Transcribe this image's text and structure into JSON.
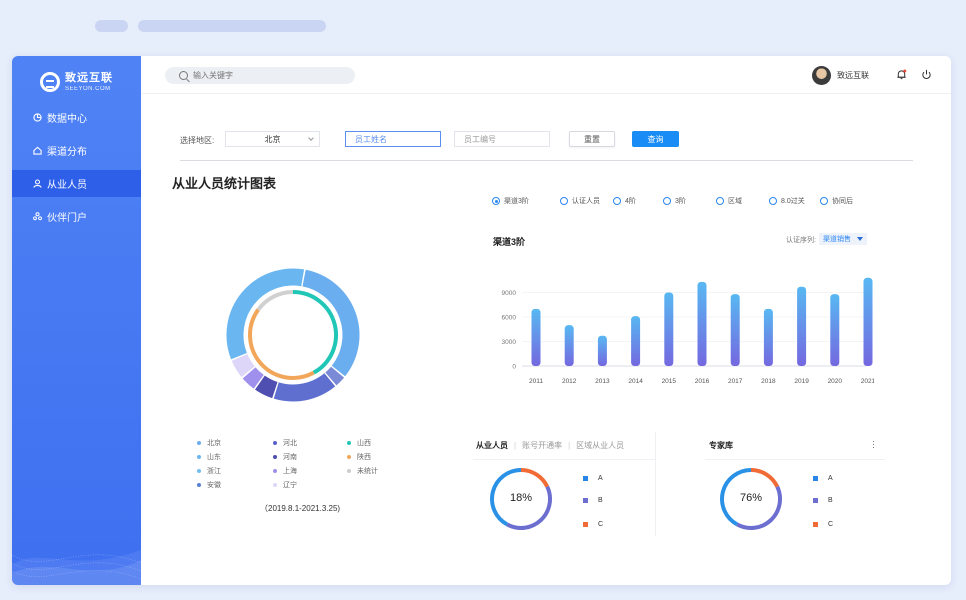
{
  "brand": {
    "name_cn": "致远互联",
    "name_en": "SEEYON.COM"
  },
  "sidebar": {
    "items": [
      {
        "label": "数据中心",
        "icon": "pie-chart-icon",
        "active": false
      },
      {
        "label": "渠道分布",
        "icon": "home-icon",
        "active": false
      },
      {
        "label": "从业人员",
        "icon": "user-icon",
        "active": true
      },
      {
        "label": "伙伴门户",
        "icon": "partners-icon",
        "active": false
      }
    ]
  },
  "topbar": {
    "search_placeholder": "输入关键字",
    "username": "致远互联"
  },
  "filter": {
    "region_label": "选择地区:",
    "region_value": "北京",
    "name_placeholder": "员工姓名",
    "id_placeholder": "员工编号",
    "reset_label": "重置",
    "query_label": "查询"
  },
  "section_title": "从业人员统计图表",
  "radios": [
    {
      "label": "渠道3阶",
      "checked": true
    },
    {
      "label": "认证人员",
      "checked": false
    },
    {
      "label": "4阶",
      "checked": false
    },
    {
      "label": "3阶",
      "checked": false
    },
    {
      "label": "区域",
      "checked": false
    },
    {
      "label": "8.0过关",
      "checked": false
    },
    {
      "label": "协同后",
      "checked": false
    }
  ],
  "legend": [
    {
      "label": "北京",
      "color": "#6aaef0"
    },
    {
      "label": "河北",
      "color": "#5a5fc8"
    },
    {
      "label": "山西",
      "color": "#20c6b6"
    },
    {
      "label": "山东",
      "color": "#69b6f0"
    },
    {
      "label": "河南",
      "color": "#4e4fb0"
    },
    {
      "label": "陕西",
      "color": "#f2a65a"
    },
    {
      "label": "浙江",
      "color": "#76bdf2"
    },
    {
      "label": "上海",
      "color": "#9e90ec"
    },
    {
      "label": "未统计",
      "color": "#cccccc"
    },
    {
      "label": "安徽",
      "color": "#5a80d6"
    },
    {
      "label": "辽宁",
      "color": "#ddd6f8"
    }
  ],
  "date_range": "（2019.8.1-2021.3.25)",
  "bar_panel": {
    "title": "渠道3阶",
    "series_label": "认证序列:",
    "series_value": "渠道销售"
  },
  "chart_data": [
    {
      "type": "pie",
      "subtype": "double-ring",
      "outer": [
        {
          "name": "北京",
          "value": 33,
          "color": "#6aaef0"
        },
        {
          "name": "河北",
          "value": 3,
          "color": "#7b8ad6"
        },
        {
          "name": "",
          "value": 16,
          "color": "#5e6fd0"
        },
        {
          "name": "河南",
          "value": 5,
          "color": "#4e4fb0"
        },
        {
          "name": "上海",
          "value": 4,
          "color": "#9e90ec"
        },
        {
          "name": "辽宁",
          "value": 5,
          "color": "#ddd6f8"
        },
        {
          "name": "山东",
          "value": 34,
          "color": "#69b6f0"
        }
      ],
      "inner": [
        {
          "name": "山西",
          "value": 42,
          "color": "#20c6b6"
        },
        {
          "name": "陕西",
          "value": 43,
          "color": "#f2a65a"
        },
        {
          "name": "未统计",
          "value": 15,
          "color": "#d0d0d0"
        }
      ]
    },
    {
      "type": "bar",
      "categories": [
        "2011",
        "2012",
        "2013",
        "2014",
        "2015",
        "2016",
        "2017",
        "2018",
        "2019",
        "2020",
        "2021"
      ],
      "values": [
        7000,
        5000,
        3700,
        6100,
        9000,
        10300,
        8800,
        7000,
        9700,
        8800,
        10800
      ],
      "yticks": [
        0,
        3000,
        6000,
        9000
      ],
      "ytick_labels": [
        "0",
        "3000",
        "6000",
        "9000"
      ],
      "ylim": [
        0,
        12000
      ]
    },
    {
      "type": "pie",
      "subtype": "ring",
      "label": "18%",
      "segments": [
        {
          "name": "C",
          "value": 18,
          "color": "#f06b36"
        },
        {
          "name": "B",
          "value": 40,
          "color": "#6c6fcf"
        },
        {
          "name": "A",
          "value": 42,
          "color": "#2a92e6"
        }
      ]
    },
    {
      "type": "pie",
      "subtype": "ring",
      "label": "76%",
      "segments": [
        {
          "name": "C",
          "value": 18,
          "color": "#f06b36"
        },
        {
          "name": "B",
          "value": 40,
          "color": "#6c6fcf"
        },
        {
          "name": "A",
          "value": 42,
          "color": "#2a92e6"
        }
      ]
    }
  ],
  "panel_left": {
    "tabs": [
      {
        "label": "从业人员",
        "active": true
      },
      {
        "label": "账号开通率",
        "active": false
      },
      {
        "label": "区域从业人员",
        "active": false
      }
    ],
    "legend": [
      {
        "label": "A",
        "color": "#2a86e6"
      },
      {
        "label": "B",
        "color": "#6c6fcf"
      },
      {
        "label": "C",
        "color": "#f06b36"
      }
    ]
  },
  "panel_right": {
    "title": "专家库",
    "legend": [
      {
        "label": "A",
        "color": "#2a86e6"
      },
      {
        "label": "B",
        "color": "#6c6fcf"
      },
      {
        "label": "C",
        "color": "#f06b36"
      }
    ]
  }
}
